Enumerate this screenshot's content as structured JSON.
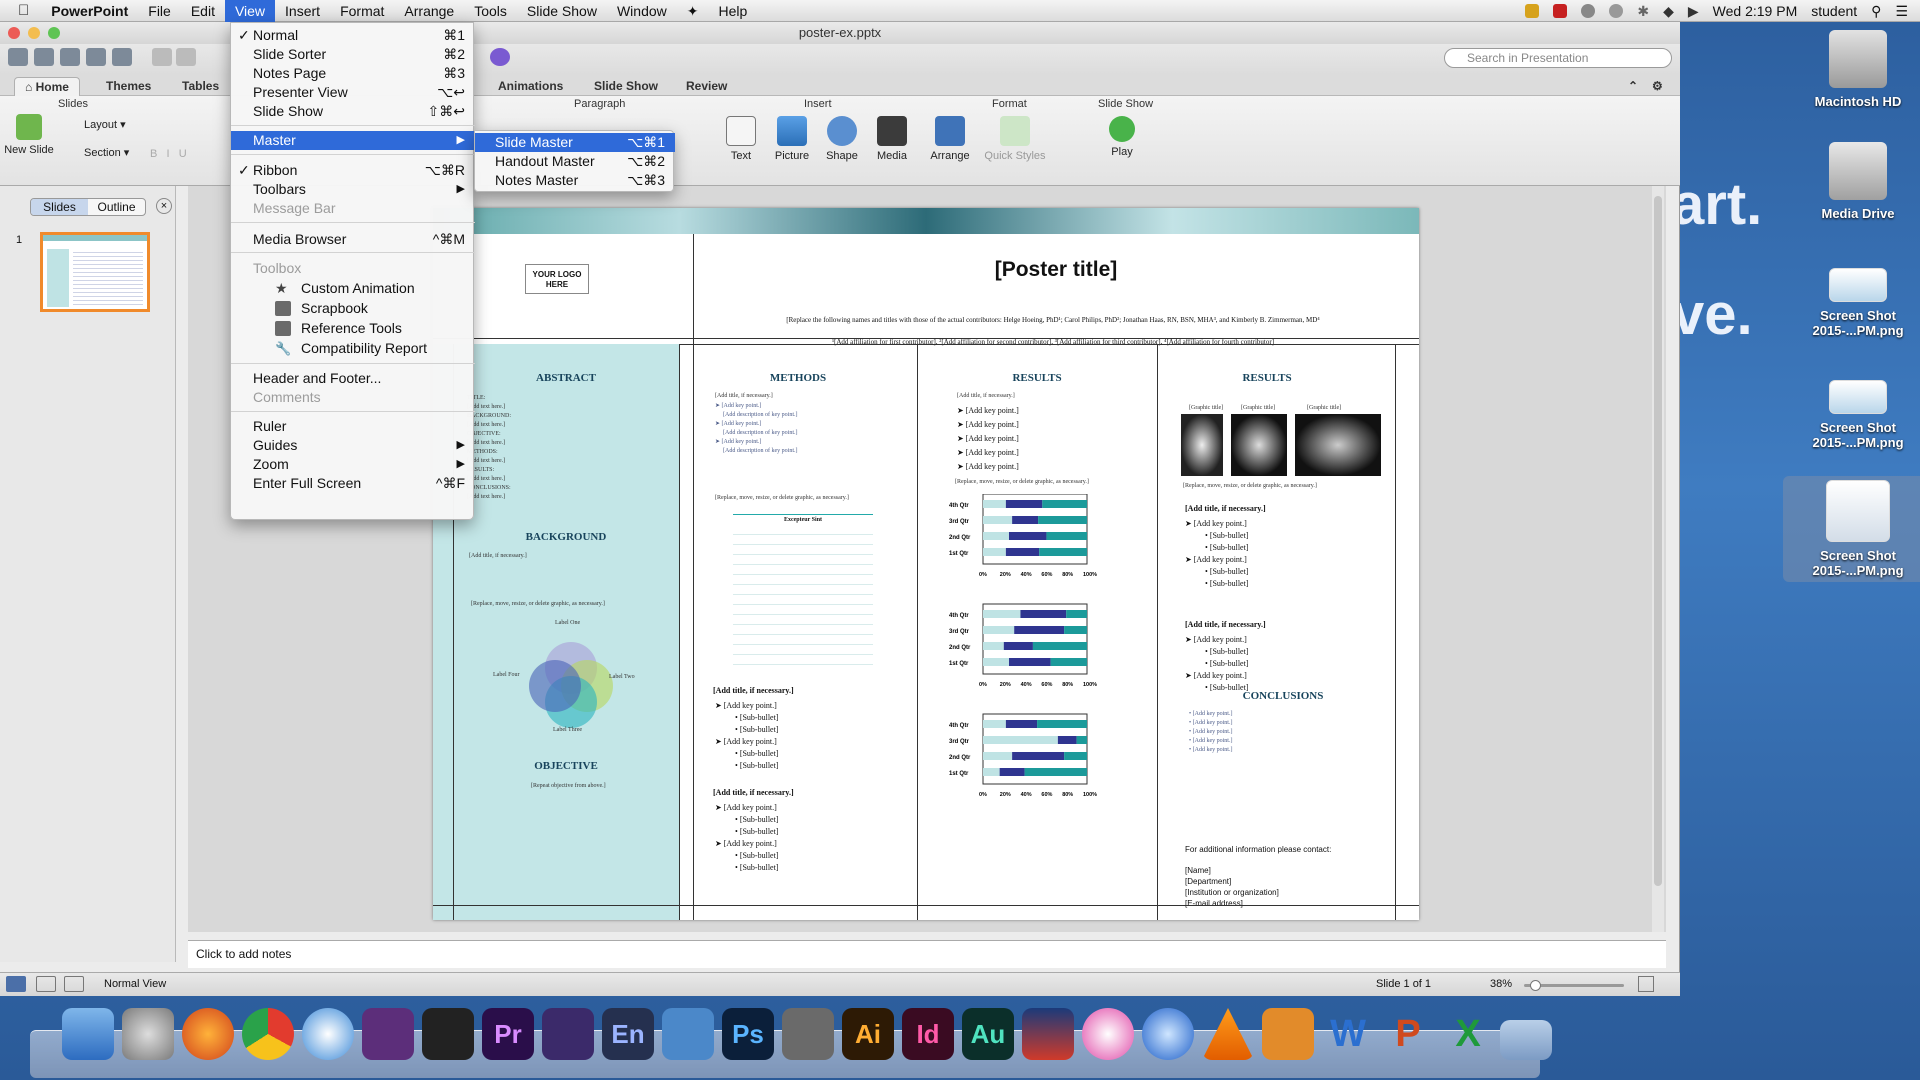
{
  "menubar": {
    "apple": "",
    "app": "PowerPoint",
    "items": [
      "File",
      "Edit",
      "View",
      "Insert",
      "Format",
      "Arrange",
      "Tools",
      "Slide Show",
      "Window",
      "Help"
    ],
    "active": "View",
    "clock": "Wed 2:19 PM",
    "user": "student"
  },
  "window": {
    "title": "poster-ex.pptx"
  },
  "search": {
    "placeholder": "Search in Presentation"
  },
  "ribbon_tabs": [
    "Home",
    "Themes",
    "Tables",
    "Animations",
    "Slide Show",
    "Review"
  ],
  "ribbon": {
    "groups": {
      "slides": "Slides",
      "paragraph": "Paragraph",
      "insert": "Insert",
      "format": "Format",
      "slideshow": "Slide Show"
    },
    "new_slide": "New Slide",
    "layout": "Layout",
    "section": "Section",
    "insert_buttons": [
      "Text",
      "Picture",
      "Shape",
      "Media"
    ],
    "format_buttons": [
      "Arrange",
      "Quick Styles"
    ],
    "play": "Play"
  },
  "view_menu": {
    "items": [
      {
        "label": "Normal",
        "shortcut": "⌘1",
        "checked": true
      },
      {
        "label": "Slide Sorter",
        "shortcut": "⌘2"
      },
      {
        "label": "Notes Page",
        "shortcut": "⌘3"
      },
      {
        "label": "Presenter View",
        "shortcut": "⌥↩"
      },
      {
        "label": "Slide Show",
        "shortcut": "⇧⌘↩"
      },
      {
        "label": "Master",
        "submenu": true,
        "highlighted": true
      },
      {
        "label": "Ribbon",
        "shortcut": "⌥⌘R",
        "checked": true
      },
      {
        "label": "Toolbars",
        "submenu": true
      },
      {
        "label": "Message Bar",
        "disabled": true
      },
      {
        "label": "Media Browser",
        "shortcut": "^⌘M"
      },
      {
        "label": "Toolbox",
        "disabled": true
      },
      {
        "label": "Custom Animation",
        "icon": "star-icon"
      },
      {
        "label": "Scrapbook",
        "icon": "scrapbook-icon"
      },
      {
        "label": "Reference Tools",
        "icon": "books-icon"
      },
      {
        "label": "Compatibility Report",
        "icon": "wrench-icon"
      },
      {
        "label": "Header and Footer..."
      },
      {
        "label": "Comments",
        "disabled": true
      },
      {
        "label": "Ruler"
      },
      {
        "label": "Guides",
        "submenu": true
      },
      {
        "label": "Zoom",
        "submenu": true
      },
      {
        "label": "Enter Full Screen",
        "shortcut": "^⌘F"
      }
    ],
    "check_mark": "✓",
    "arrow": "▶"
  },
  "master_submenu": {
    "items": [
      {
        "label": "Slide Master",
        "shortcut": "⌥⌘1",
        "highlighted": true
      },
      {
        "label": "Handout Master",
        "shortcut": "⌥⌘2"
      },
      {
        "label": "Notes Master",
        "shortcut": "⌥⌘3"
      }
    ]
  },
  "left_pane": {
    "tabs": [
      "Slides",
      "Outline"
    ],
    "slide_number": "1"
  },
  "slide": {
    "logo": "YOUR LOGO HERE",
    "title": "[Poster title]",
    "contributors": "[Replace the following names and titles with those of the actual contributors: Helge Hoeing, PhD¹; Carol Philips, PhD²; Jonathan Haas, RN, BSN, MHA³, and Kimberly B. Zimmerman, MD⁴",
    "affiliations": "¹[Add affiliation for first contributor], ²[Add affiliation for second contributor], ³[Add affiliation for third contributor], ⁴[Add affiliation for fourth contributor]",
    "headings": {
      "abstract": "ABSTRACT",
      "background": "BACKGROUND",
      "objective": "OBJECTIVE",
      "methods": "METHODS",
      "results1": "RESULTS",
      "results2": "RESULTS",
      "conclusions": "CONCLUSIONS"
    },
    "abstract_items": [
      "TITLE:",
      "[Add text here.]",
      "BACKGROUND:",
      "[Add text here.]",
      "OBJECTIVE:",
      "[Add text here.]",
      "METHODS:",
      "[Add text here.]",
      "RESULTS:",
      "[Add text here.]",
      "CONCLUSIONS:",
      "[Add text here.]"
    ],
    "add_title": "[Add title, if necessary.]",
    "add_key_point": "[Add key point.]",
    "sub_bullet": "[Sub-bullet]",
    "replace_graphic": "[Replace, move, resize, or delete graphic, as necessary.]",
    "venn_labels": [
      "Label One",
      "Label Two",
      "Label Three",
      "Label Four"
    ],
    "objective_text": "[Repeat objective from above.]",
    "table_title": "Excepteur Sint",
    "graphic_title": "[Graphic title]",
    "chart_categories": [
      "4th Qtr",
      "3rd Qtr",
      "2nd Qtr",
      "1st Qtr"
    ],
    "chart_ticks": [
      "0%",
      "20%",
      "40%",
      "60%",
      "80%",
      "100%"
    ],
    "contact": {
      "intro": "For additional information please contact:",
      "lines": [
        "[Name]",
        "[Department]",
        "[Institution or organization]",
        "[E-mail address]"
      ]
    }
  },
  "notes": {
    "placeholder": "Click to add notes"
  },
  "status": {
    "view": "Normal View",
    "slide": "Slide 1 of 1",
    "zoom": "38%"
  },
  "desktop": {
    "icons": [
      "Macintosh HD",
      "Media Drive",
      "Screen Shot 2015-...PM.png",
      "Screen Shot 2015-...PM.png",
      "Screen Shot 2015-...PM.png"
    ],
    "bg_text": [
      "art.",
      "ve."
    ]
  },
  "dock": {
    "labels": [
      "Pr",
      "En",
      "Ps",
      "Ai",
      "Id",
      "Au"
    ]
  },
  "colors": {
    "menu_highlight": "#2f6ad9",
    "accent_teal": "#1c9a9a",
    "bar_navy": "#2f3590",
    "thumb_border": "#f08a2b"
  }
}
